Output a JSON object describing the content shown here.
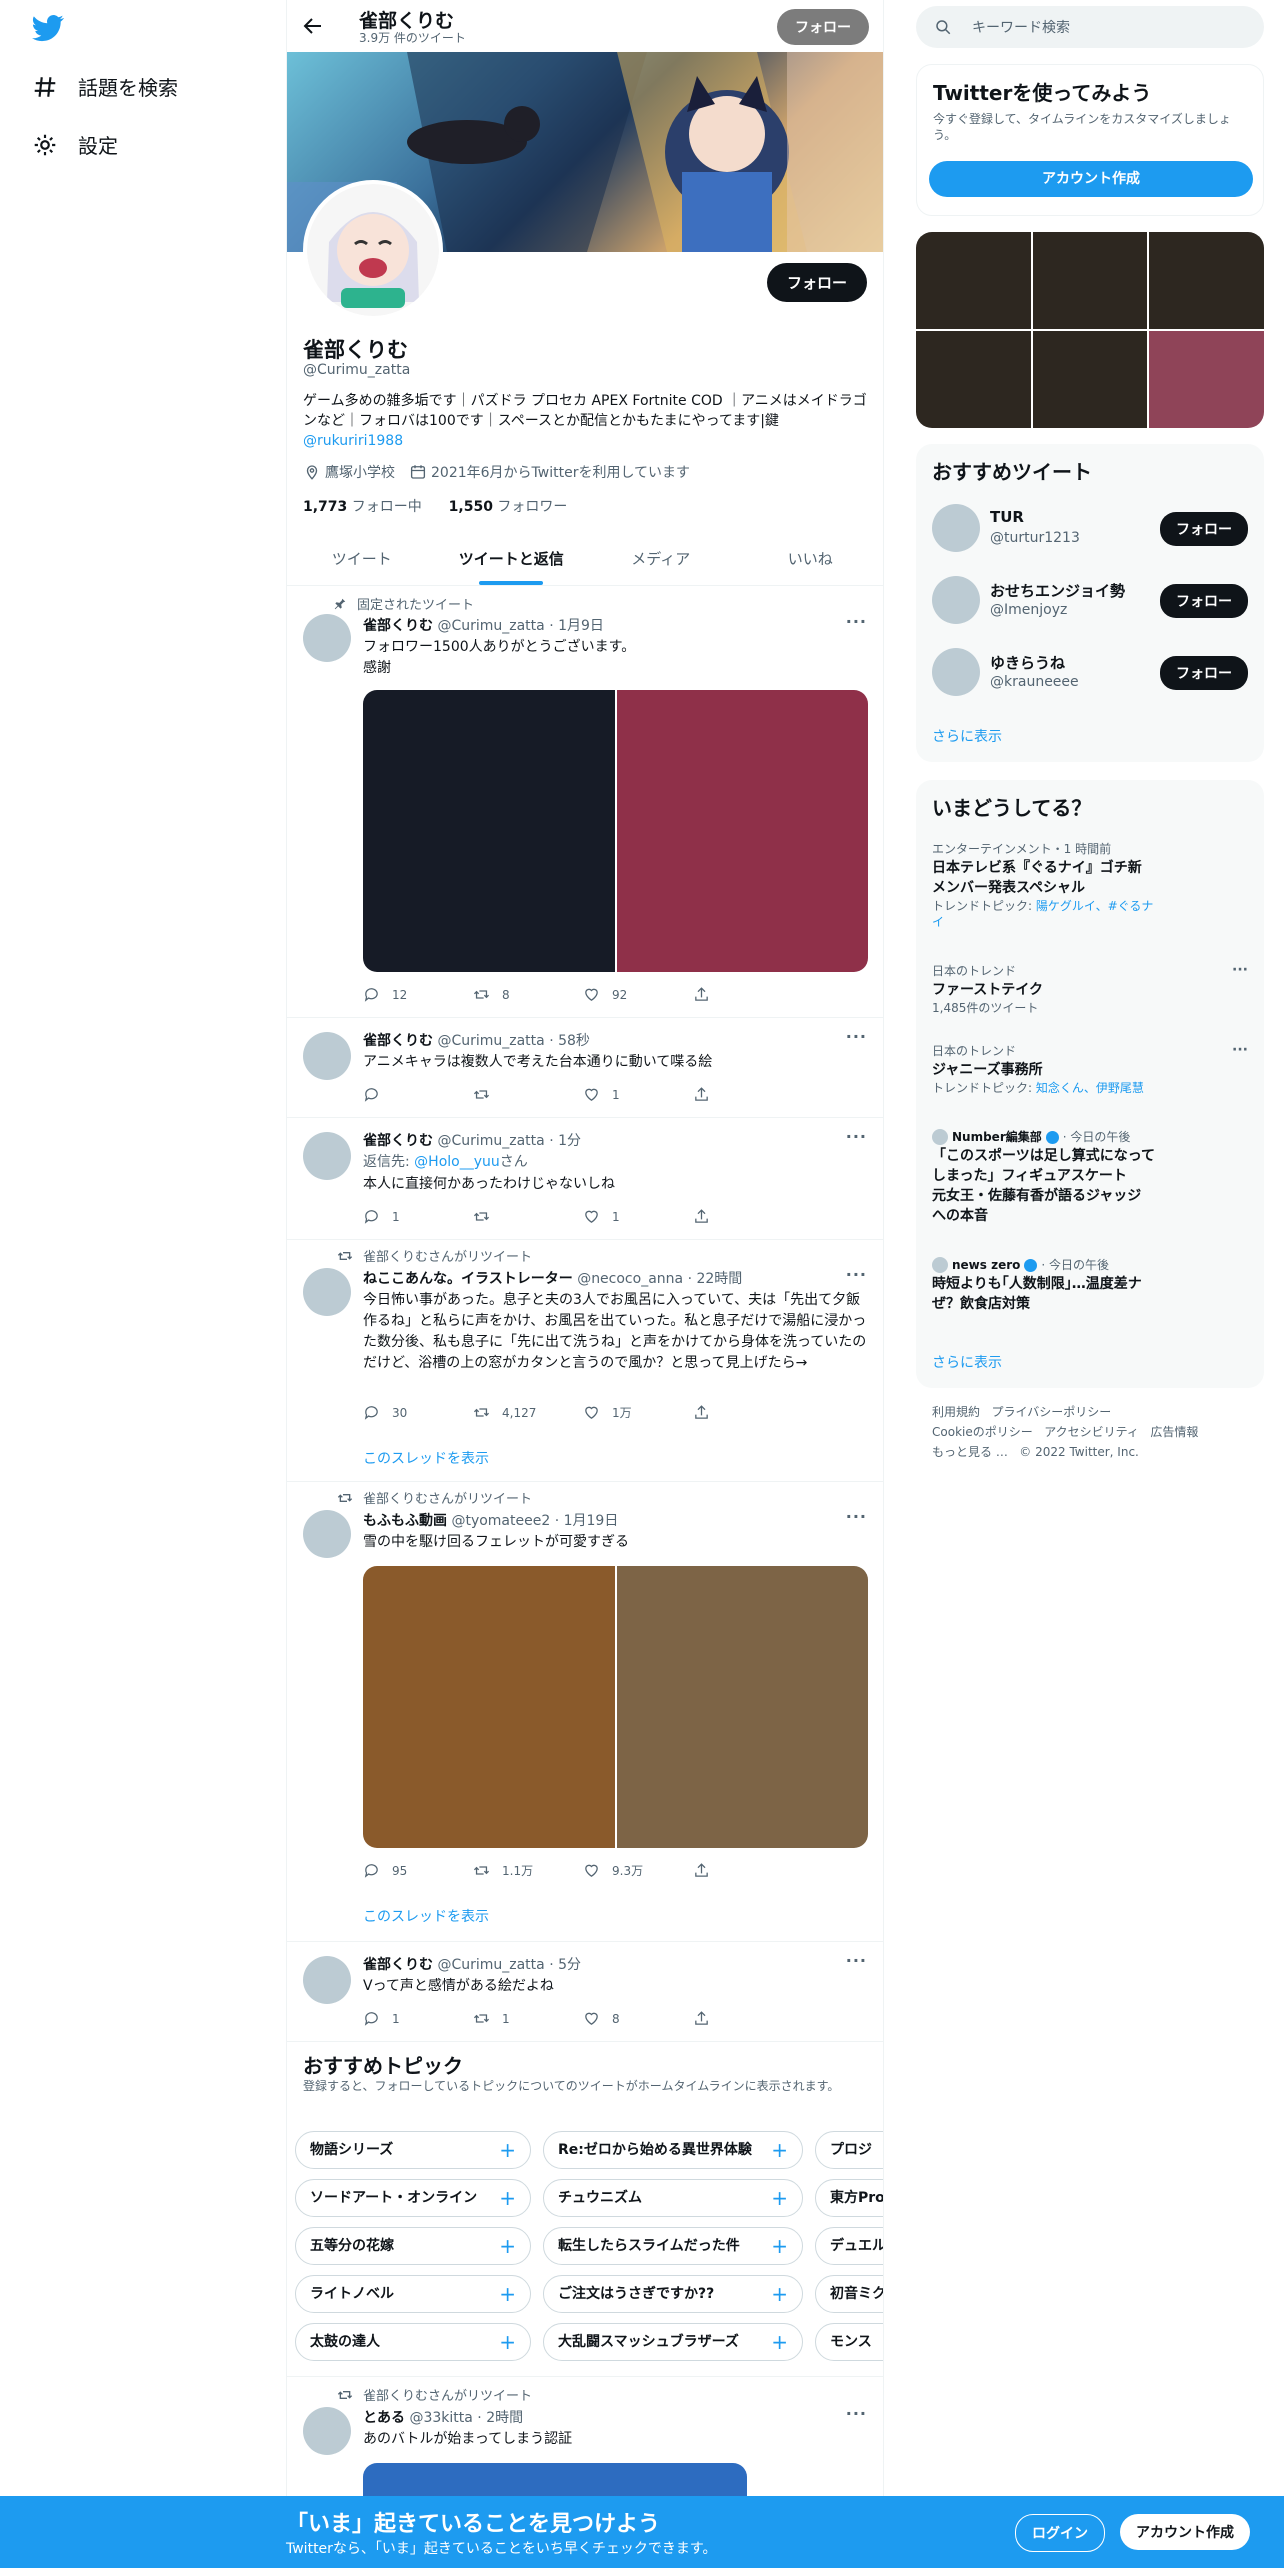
{
  "nav": {
    "explore": "話題を検索",
    "settings": "設定"
  },
  "topbar": {
    "name": "雀部くりむ",
    "tweet_count": "3.9万 件のツイート",
    "follow": "フォロー"
  },
  "profile": {
    "name": "雀部くりむ",
    "handle": "@Curimu_zatta",
    "bio": "ゲーム多めの雑多垢です｜パズドラ プロセカ APEX Fortnite COD ｜アニメはメイドラゴンなど｜フォロバは100です｜スペースとか配信とかもたまにやってます|鍵",
    "bio_link": "@rukuriri1988",
    "location": "鷹塚小学校",
    "joined": "2021年6月からTwitterを利用しています",
    "following_count": "1,773",
    "following_label": "フォロー中",
    "followers_count": "1,550",
    "followers_label": "フォロワー",
    "follow": "フォロー"
  },
  "tabs": [
    "ツイート",
    "ツイートと返信",
    "メディア",
    "いいね"
  ],
  "tweets": [
    {
      "pinned": "固定されたツイート",
      "name": "雀部くりむ",
      "handle": "@Curimu_zatta",
      "time": "1月9日",
      "text1": "フォロワー1500人ありがとうございます。",
      "text2": "感謝",
      "reply": "12",
      "retweet": "8",
      "like": "92",
      "colors": [
        "#161b26",
        "#8f3049"
      ]
    },
    {
      "name": "雀部くりむ",
      "handle": "@Curimu_zatta",
      "time": "58秒",
      "text": "アニメキャラは複数人で考えた台本通りに動いて喋る絵",
      "reply": "",
      "retweet": "",
      "like": "1"
    },
    {
      "name": "雀部くりむ",
      "handle": "@Curimu_zatta",
      "time": "1分",
      "reply_prefix": "返信先: ",
      "reply_to": "@Holo__yuu",
      "reply_suffix": "さん",
      "text": "本人に直接何かあったわけじゃないしね",
      "reply": "1",
      "retweet": "",
      "like": "1"
    },
    {
      "retweeted": "雀部くりむさんがリツイート",
      "name": "ねここあんな。イラストレーター",
      "handle": "@necoco_anna",
      "time": "22時間",
      "text": "今日怖い事があった。息子と夫の3人でお風呂に入っていて、夫は「先出て夕飯作るね」と私らに声をかけ、お風呂を出ていった。私と息子だけで湯船に浸かった数分後、私も息子に「先に出て洗うね」と声をかけてから身体を洗っていたのだけど、浴槽の上の窓がカタンと言うので風か？と思って見上げたら→",
      "reply": "30",
      "retweet": "4,127",
      "like": "1万",
      "show_thread": "このスレッドを表示"
    },
    {
      "retweeted": "雀部くりむさんがリツイート",
      "name": "もふもふ動画",
      "handle": "@tyomateee2",
      "time": "1月19日",
      "text": "雪の中を駆け回るフェレットが可愛すぎる",
      "reply": "95",
      "retweet": "1.1万",
      "like": "9.3万",
      "show_thread": "このスレッドを表示",
      "colors": [
        "#8a5a2b",
        "#7d6446"
      ]
    },
    {
      "name": "雀部くりむ",
      "handle": "@Curimu_zatta",
      "time": "5分",
      "text": "Vって声と感情がある絵だよね",
      "reply": "1",
      "retweet": "1",
      "like": "8"
    },
    {
      "retweeted": "雀部くりむさんがリツイート",
      "name": "とある",
      "handle": "@33kitta",
      "time": "2時間",
      "text": "あのバトルが始まってしまう認証"
    }
  ],
  "topics": {
    "title": "おすすめトピック",
    "subtitle": "登録すると、フォローしているトピックについてのツイートがホームタイムラインに表示されます。",
    "rows": [
      [
        "物語シリーズ",
        "Re:ゼロから始める異世界体験",
        "プロジ"
      ],
      [
        "ソードアート・オンライン",
        "チュウニズム",
        "東方Pro"
      ],
      [
        "五等分の花嫁",
        "転生したらスライムだった件",
        "デュエル"
      ],
      [
        "ライトノベル",
        "ご注文はうさぎですか??",
        "初音ミク"
      ],
      [
        "太鼓の達人",
        "大乱闘スマッシュブラザーズ",
        "モンス"
      ]
    ]
  },
  "search": {
    "placeholder": "キーワード検索"
  },
  "cta": {
    "title": "Twitterを使ってみよう",
    "subtitle": "今すぐ登録して、タイムラインをカスタマイズしましょう。",
    "button": "アカウント作成"
  },
  "media_grid_colors": [
    "#2d2720",
    "#2d2720",
    "#2d2720",
    "#2d2720",
    "#2d2720",
    "#8f4458"
  ],
  "recommended": {
    "title": "おすすめツイート",
    "accounts": [
      {
        "name": "TUR",
        "handle": "@turtur1213",
        "button": "フォロー"
      },
      {
        "name": "おせちエンジョイ勢",
        "handle": "@Imenjoyz",
        "button": "フォロー"
      },
      {
        "name": "ゆきらうね",
        "handle": "@krauneeee",
        "button": "フォロー"
      }
    ],
    "more": "さらに表示"
  },
  "trends": {
    "title": "いまどうしてる？",
    "items": [
      {
        "context": "エンターテインメント・1 時間前",
        "title1": "日本テレビ系『ぐるナイ』ゴチ新",
        "title2": "メンバー発表スペシャル",
        "sub_prefix": "トレンドトピック: ",
        "sub_link1": "陽ケグルイ、#ぐるナイ"
      },
      {
        "context": "日本のトレンド",
        "title": "ファーストテイク",
        "sub": "1,485件のツイート"
      },
      {
        "context": "日本のトレンド",
        "title": "ジャニーズ事務所",
        "sub_prefix": "トレンドトピック: ",
        "sub_link1": "知念くん、伊野尾慧"
      },
      {
        "source": "Number編集部",
        "time": "今日の午後",
        "lines": [
          "「このスポーツは足し算式になって",
          "しまった」フィギュアスケート",
          "元女王・佐藤有香が語るジャッジ",
          "への本音"
        ]
      },
      {
        "source": "news zero",
        "time": "今日の午後",
        "lines": [
          "時短よりも｢人数制限｣…温度差ナ",
          "ぜ？飲食店対策"
        ]
      }
    ],
    "more": "さらに表示"
  },
  "footer": {
    "terms": "利用規約",
    "privacy": "プライバシーポリシー",
    "cookie": "Cookieのポリシー",
    "accessibility": "アクセシビリティ",
    "ads": "広告情報",
    "more": "もっと見る …",
    "copyright": "© 2022 Twitter, Inc."
  },
  "bottom_bar": {
    "title": "「いま」起きていることを見つけよう",
    "subtitle": "Twitterなら、「いま」起きていることをいち早くチェックできます。",
    "login": "ログイン",
    "signup": "アカウント作成"
  },
  "colors": {
    "accent": "#1d9bf0",
    "text": "#0f1419",
    "muted": "#536471"
  }
}
